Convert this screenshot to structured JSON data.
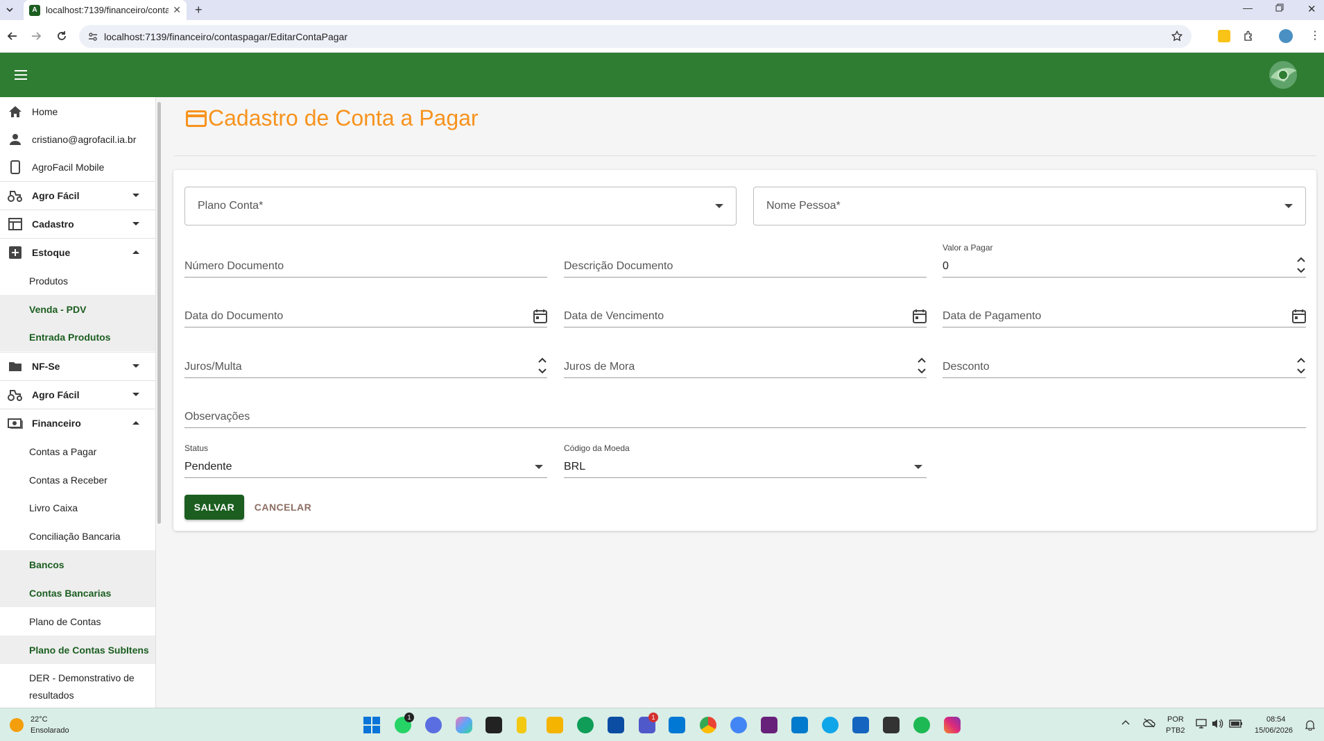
{
  "browser": {
    "tab_title": "localhost:7139/financeiro/conta",
    "url": "localhost:7139/financeiro/contaspagar/EditarContaPagar"
  },
  "sidebar": {
    "items": [
      {
        "label": "Home"
      },
      {
        "label": "cristiano@agrofacil.ia.br"
      },
      {
        "label": "AgroFacil Mobile"
      },
      {
        "label": "Agro Fácil"
      },
      {
        "label": "Cadastro"
      },
      {
        "label": "Estoque"
      },
      {
        "label": "Produtos"
      },
      {
        "label": "Venda - PDV"
      },
      {
        "label": "Entrada Produtos"
      },
      {
        "label": "NF-Se"
      },
      {
        "label": "Agro Fácil"
      },
      {
        "label": "Financeiro"
      },
      {
        "label": "Contas a Pagar"
      },
      {
        "label": "Contas a Receber"
      },
      {
        "label": "Livro Caixa"
      },
      {
        "label": "Conciliação Bancaria"
      },
      {
        "label": "Bancos"
      },
      {
        "label": "Contas Bancarias"
      },
      {
        "label": "Plano de Contas"
      },
      {
        "label": "Plano de Contas SubItens"
      },
      {
        "label": "DER - Demonstrativo de resultados"
      }
    ]
  },
  "page": {
    "title": "Cadastro de Conta a Pagar"
  },
  "form": {
    "plano_conta": "Plano Conta*",
    "nome_pessoa": "Nome Pessoa*",
    "numero_documento": "Número Documento",
    "descricao_documento": "Descrição Documento",
    "valor_pagar_label": "Valor a Pagar",
    "valor_pagar_value": "0",
    "data_documento": "Data do Documento",
    "data_vencimento": "Data de Vencimento",
    "data_pagamento": "Data de Pagamento",
    "juros_multa": "Juros/Multa",
    "juros_mora": "Juros de Mora",
    "desconto": "Desconto",
    "observacoes": "Observações",
    "status_label": "Status",
    "status_value": "Pendente",
    "moeda_label": "Código da Moeda",
    "moeda_value": "BRL",
    "save_label": "SALVAR",
    "cancel_label": "CANCELAR"
  },
  "taskbar": {
    "weather_temp": "22°C",
    "weather_desc": "Ensolarado",
    "lang_top": "POR",
    "lang_bottom": "PTB2",
    "time": "08:54",
    "date": "15/06/2026",
    "whatsapp_badge": "1",
    "teams_badge": "1"
  },
  "colors": {
    "header_green": "#2e7d32",
    "title_orange": "#f7931e",
    "save_green": "#1b5e20"
  }
}
